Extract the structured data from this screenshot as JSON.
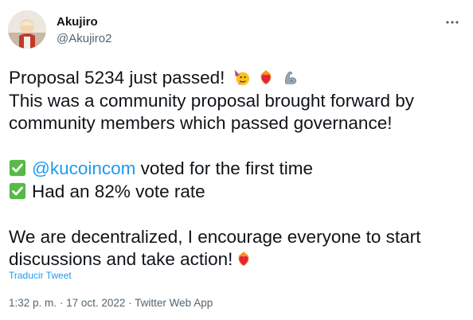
{
  "tweet": {
    "display_name": "Akujiro",
    "handle": "@Akujiro2",
    "more_icon": "more-horizontal-icon",
    "text": {
      "line1": "Proposal 5234 just passed!",
      "line2": "This was a community proposal brought forward by",
      "line3": "community members which passed governance!",
      "mention": "@kucoincom",
      "line4_rest": " voted for the first time",
      "line5": "Had an 82% vote rate",
      "line6": "We are decentralized, I encourage everyone to start",
      "line7": "discussions and take action!"
    },
    "emojis": [
      "partying-face-emoji",
      "heart-on-fire-emoji",
      "mechanical-arm-emoji"
    ],
    "translate_label": "Traducir Tweet",
    "meta": {
      "time": "1:32 p. m.",
      "separator": "·",
      "date": "17 oct. 2022",
      "source": "Twitter Web App"
    },
    "colors": {
      "text": "#0f1419",
      "secondary": "#536471",
      "link": "#1d9bf0",
      "check_green": "#58b947"
    }
  }
}
